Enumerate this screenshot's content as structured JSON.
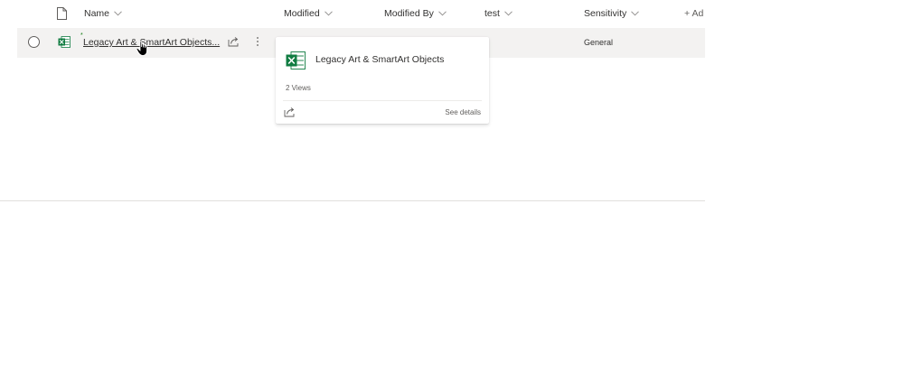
{
  "header": {
    "name_label": "Name",
    "modified_label": "Modified",
    "modified_by_label": "Modified By",
    "test_label": "test",
    "sensitivity_label": "Sensitivity",
    "add_column_label": "+ Ad"
  },
  "rows": [
    {
      "file_name": "Legacy Art & SmartArt Objects...",
      "new_indicator": "*",
      "sensitivity": "General",
      "file_icon": "excel-file-icon"
    }
  ],
  "hover_card": {
    "title": "Legacy Art & SmartArt Objects",
    "views": "2 Views",
    "details_link": "See details",
    "file_icon": "excel-file-icon"
  },
  "colors": {
    "excel_green": "#107c41",
    "row_hover": "#f3f2f1",
    "text": "#323130",
    "secondary_text": "#605e5c"
  }
}
